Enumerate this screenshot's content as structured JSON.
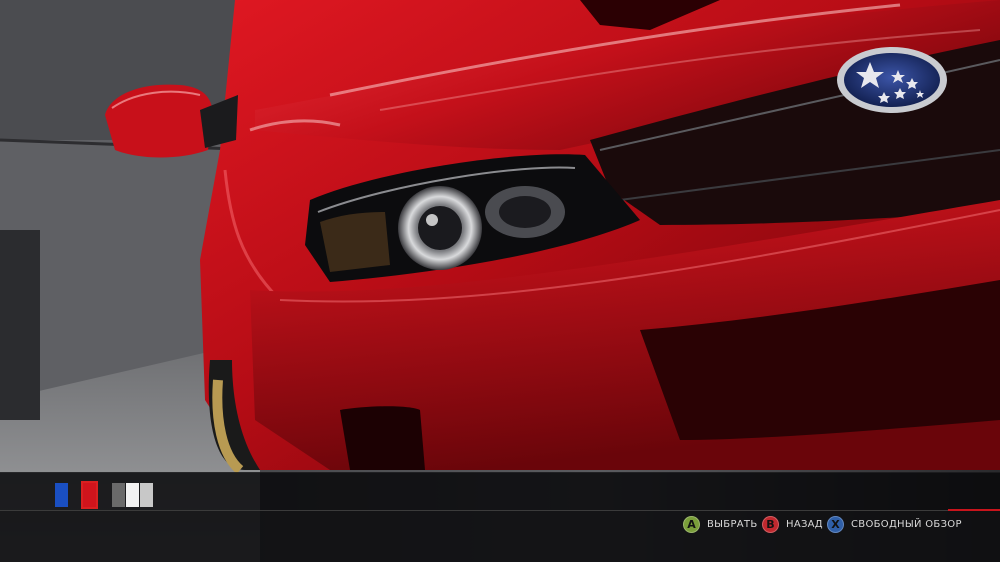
{
  "scene": {
    "subject": "red-car-front-closeup",
    "body_color": "#c8101a"
  },
  "paint_swatches": {
    "selected": "red",
    "items": [
      {
        "name": "blue",
        "color": "#1a4fc2"
      },
      {
        "name": "red",
        "color": "#d0141c"
      },
      {
        "name": "dark-gray",
        "color": "#6a6a6a"
      },
      {
        "name": "white",
        "color": "#f2f2f2"
      },
      {
        "name": "light-gray",
        "color": "#c8c8c8"
      }
    ]
  },
  "prompts": [
    {
      "button": "A",
      "label": "ВЫБРАТЬ",
      "color": "#7a9e3a"
    },
    {
      "button": "B",
      "label": "НАЗАД",
      "color": "#c0282e"
    },
    {
      "button": "X",
      "label": "СВОБОДНЫЙ ОБЗОР",
      "color": "#2f5fa8"
    }
  ],
  "accent_color": "#c8141c"
}
